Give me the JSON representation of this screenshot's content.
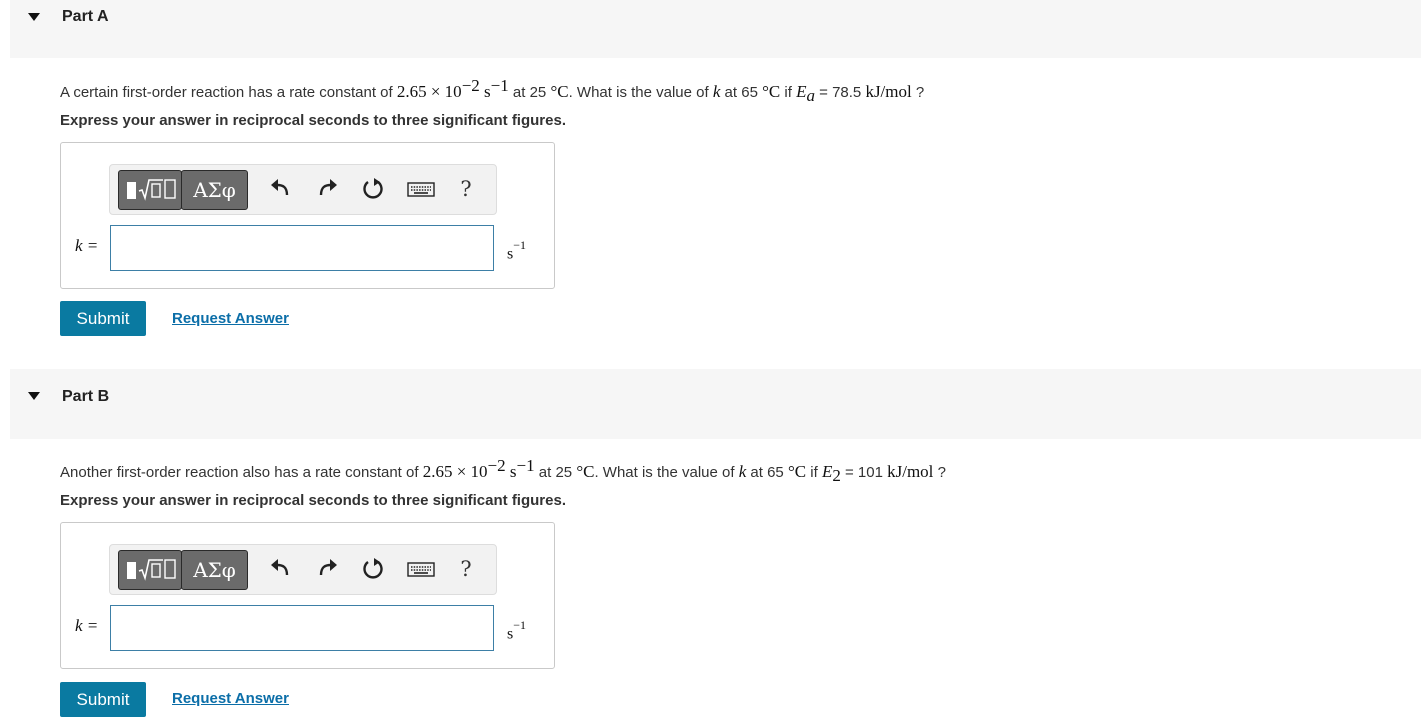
{
  "parts": [
    {
      "title": "Part A",
      "question": {
        "t1": "A certain first-order reaction has a rate constant of ",
        "m1": "2.65 × 10",
        "m1_exp": "−2",
        "m2": " s",
        "m2_exp": "−1",
        "t2": " at 25 ",
        "m3": "°C",
        "t3": ". What is the value of ",
        "m4": "k",
        "t4": " at 65 ",
        "m5": "°C",
        "t5": " if ",
        "m6": "E",
        "m6_sub": "a",
        "t6": " = 78.5 ",
        "m7": "kJ/mol",
        "t7": " ?"
      },
      "instruction": "Express your answer in reciprocal seconds to three significant figures.",
      "var_label": "k =",
      "answer_value": "",
      "unit": "s",
      "unit_exp": "−1",
      "toolbar": {
        "greek": "ΑΣφ",
        "help": "?"
      },
      "submit": "Submit",
      "request": "Request Answer"
    },
    {
      "title": "Part B",
      "question": {
        "t1": "Another first-order reaction also has a rate constant of ",
        "m1": "2.65 × 10",
        "m1_exp": "−2",
        "m2": " s",
        "m2_exp": "−1",
        "t2": " at 25 ",
        "m3": "°C",
        "t3": ". What is the value of ",
        "m4": "k",
        "t4": " at 65 ",
        "m5": "°C",
        "t5": " if ",
        "m6": "E",
        "m6_sub": "2",
        "t6": " = 101 ",
        "m7": "kJ/mol",
        "t7": " ?"
      },
      "instruction": "Express your answer in reciprocal seconds to three significant figures.",
      "var_label": "k =",
      "answer_value": "",
      "unit": "s",
      "unit_exp": "−1",
      "toolbar": {
        "greek": "ΑΣφ",
        "help": "?"
      },
      "submit": "Submit",
      "request": "Request Answer"
    }
  ],
  "colors": {
    "header_bg": "#f6f6f6",
    "submit_bg": "#0a7aa1",
    "link": "#0b6ea8",
    "input_border": "#3d7fa6"
  }
}
